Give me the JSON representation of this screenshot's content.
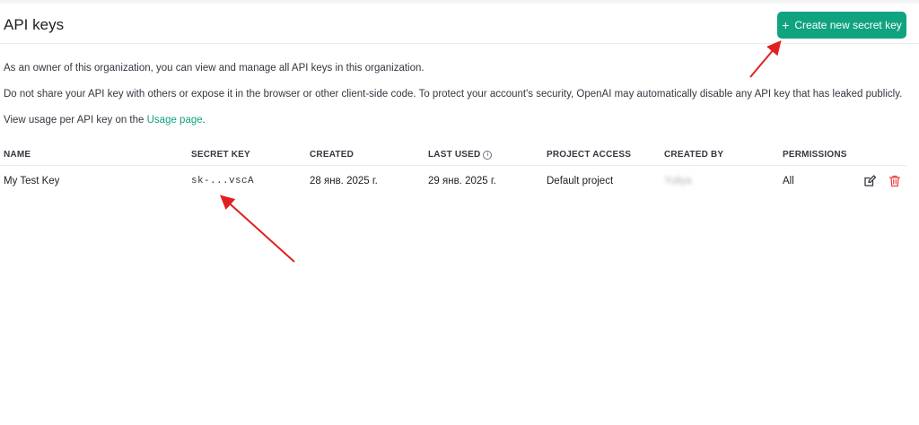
{
  "header": {
    "title": "API keys",
    "create_button_label": "Create new secret key"
  },
  "intro": {
    "line1": "As an owner of this organization, you can view and manage all API keys in this organization.",
    "line2": "Do not share your API key with others or expose it in the browser or other client-side code. To protect your account's security, OpenAI may automatically disable any API key that has leaked publicly.",
    "line3_prefix": "View usage per API key on the ",
    "line3_link": "Usage page",
    "line3_suffix": "."
  },
  "table": {
    "columns": [
      "NAME",
      "SECRET KEY",
      "CREATED",
      "LAST USED",
      "PROJECT ACCESS",
      "CREATED BY",
      "PERMISSIONS"
    ],
    "rows": [
      {
        "name": "My Test Key",
        "secret_key": "sk-...vscA",
        "created": "28 янв. 2025 г.",
        "last_used": "29 янв. 2025 г.",
        "project_access": "Default project",
        "created_by": "Yuliya",
        "permissions": "All"
      }
    ]
  },
  "icons": {
    "create": "plus-icon",
    "info": "info-icon",
    "edit": "edit-icon",
    "delete": "trash-icon"
  },
  "colors": {
    "accent": "#10a37f",
    "danger": "#ef4146",
    "annotation_arrow": "#e02020"
  }
}
